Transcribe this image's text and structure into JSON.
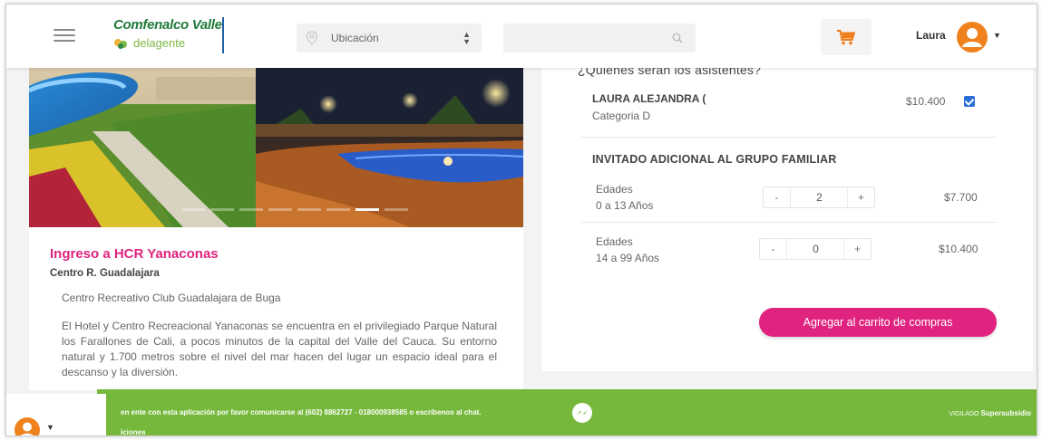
{
  "header": {
    "logo_top": "Comfenalco Valle",
    "logo_bottom": "delagente",
    "location_label": "Ubicación",
    "search_value": "",
    "user_name": "Laura"
  },
  "event": {
    "title": "Ingreso a HCR Yanaconas",
    "subtitle": "Centro R. Guadalajara",
    "place": "Centro Recreativo Club Guadalajara de Buga",
    "description": "El Hotel y Centro Recreacional Yanaconas se encuentra en el privilegiado Parque Natural los Farallones de Cali, a pocos minutos de la capital del Valle del Cauca. Su entorno natural y 1.700 metros sobre el nivel del mar hacen del lugar un espacio ideal para el descanso y la diversión."
  },
  "attendees": {
    "heading": "¿Quiénes serán los asistentes?",
    "main": {
      "name": "LAURA ALEJANDRA (",
      "category": "Categoria D",
      "price": "$10.400"
    },
    "guest_heading": "INVITADO ADICIONAL AL GRUPO FAMILIAR",
    "age_groups": [
      {
        "label": "Edades",
        "range": "0 a 13 Años",
        "minus": "-",
        "plus": "+",
        "quantity": "2",
        "price": "$7.700"
      },
      {
        "label": "Edades",
        "range": "14 a 99 Años",
        "minus": "-",
        "plus": "+",
        "quantity": "0",
        "price": "$10.400"
      }
    ],
    "add_to_cart": "Agregar al carrito de compras"
  },
  "footer": {
    "message": "en ente con esta aplicación por favor comunicarse al (602) 8862727 - 018000938585 o escríbenos al chat.",
    "message_line2": "iciones",
    "vigilance_prefix": "VIGILADO",
    "vigilance_brand": "Supersubsidio"
  },
  "colors": {
    "accent": "#e0237f",
    "footer_green": "#76b83b",
    "cart_orange": "#f07c1a",
    "brand_green": "#1f7a3a",
    "avatar_orange": "#f0821e"
  },
  "icons": {
    "menu": "hamburger-icon",
    "location": "map-pin-icon",
    "search": "search-icon",
    "cart": "cart-icon",
    "user": "user-avatar-icon",
    "chat": "chat-bubble-icon"
  }
}
